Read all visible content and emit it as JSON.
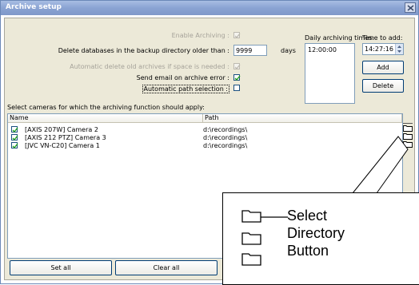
{
  "window": {
    "title": "Archive setup"
  },
  "settings": {
    "enable_archiving": {
      "label": "Enable Archiving :",
      "checked": true,
      "enabled": false
    },
    "delete_older": {
      "label": "Delete databases in the backup directory older than :",
      "value": "9999",
      "unit": "days"
    },
    "auto_delete": {
      "label": "Automatic delete old archives if space is needed :",
      "checked": true,
      "enabled": false
    },
    "send_email": {
      "label": "Send email on archive error :",
      "checked": true
    },
    "auto_path": {
      "label": "Automatic path selection :",
      "checked": false
    }
  },
  "schedule": {
    "daily_label": "Daily archiving times:",
    "times": [
      "12:00:00"
    ],
    "time_to_add_label": "Time to add:",
    "time_value": "14:27:16",
    "add_label": "Add",
    "delete_label": "Delete"
  },
  "cameras": {
    "instruction": "Select cameras for which the archiving function should apply:",
    "columns": {
      "name": "Name",
      "path": "Path"
    },
    "rows": [
      {
        "name": "[AXIS 207W] Camera 2",
        "path": "d:\\recordings\\",
        "checked": true
      },
      {
        "name": "[AXIS 212 PTZ] Camera 3",
        "path": "d:\\recordings\\",
        "checked": true
      },
      {
        "name": "[JVC VN-C20] Camera 1",
        "path": "d:\\recordings\\",
        "checked": true
      }
    ]
  },
  "footer": {
    "set_all_label": "Set all",
    "clear_all_label": "Clear all"
  },
  "callout": {
    "lines": [
      "Select",
      "Directory",
      "Button"
    ]
  },
  "colors": {
    "titlebar": "#8aa3d3",
    "dialog_bg": "#ece9d8",
    "check": "#21a121"
  }
}
